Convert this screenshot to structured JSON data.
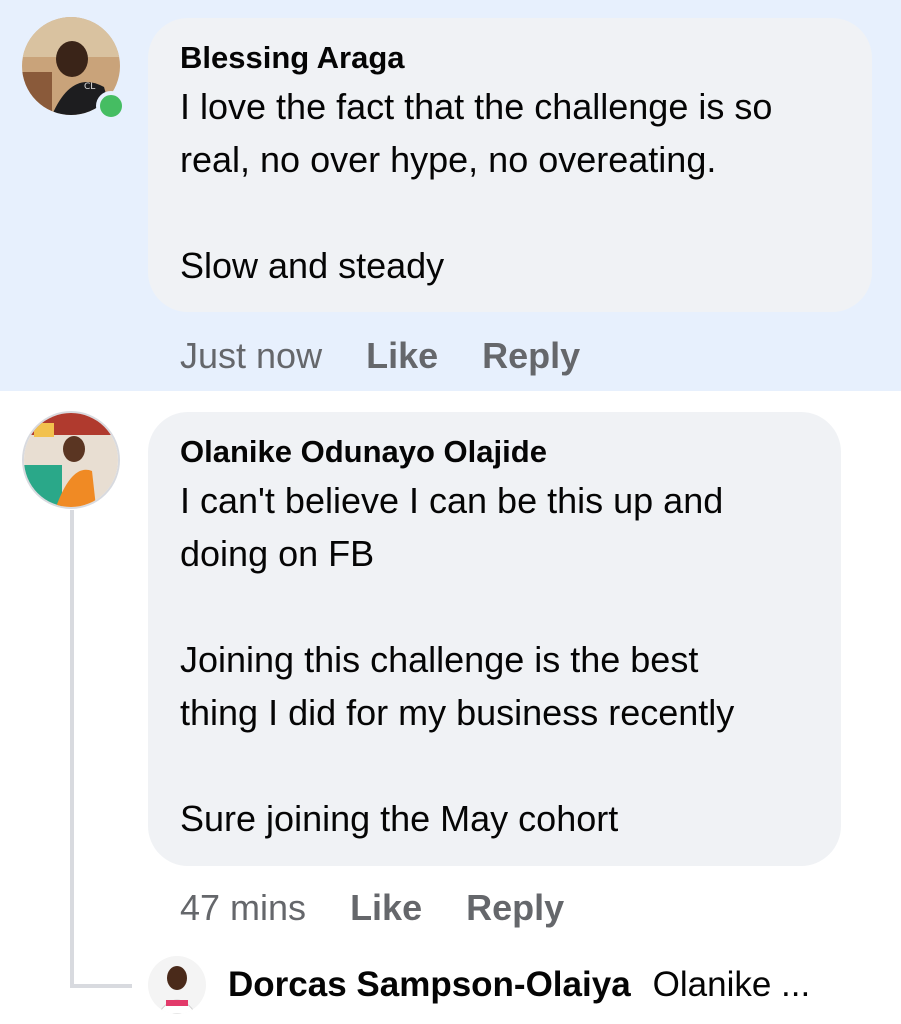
{
  "comments": [
    {
      "author": "Blessing Araga",
      "text": "I love the fact that the challenge is so\nreal, no over hype, no overeating.\n\nSlow and steady",
      "time": "Just now",
      "like_label": "Like",
      "reply_label": "Reply"
    },
    {
      "author": "Olanike Odunayo Olajide",
      "text": "I can't believe I can be this up and\ndoing on FB\n\nJoining this challenge is the best\nthing I did for my business recently\n\nSure joining the May cohort",
      "time": "47 mins",
      "like_label": "Like",
      "reply_label": "Reply"
    }
  ],
  "reply_preview": {
    "author": "Dorcas Sampson-Olaiya",
    "snippet": "Olanike ..."
  },
  "colors": {
    "highlight": "#e7f0fd",
    "bubble": "#f0f2f5",
    "meta_text": "#65676b",
    "online": "#45bd62"
  },
  "icons": [
    "avatar-blessing",
    "online-status-icon",
    "avatar-olanike",
    "avatar-dorcas"
  ]
}
